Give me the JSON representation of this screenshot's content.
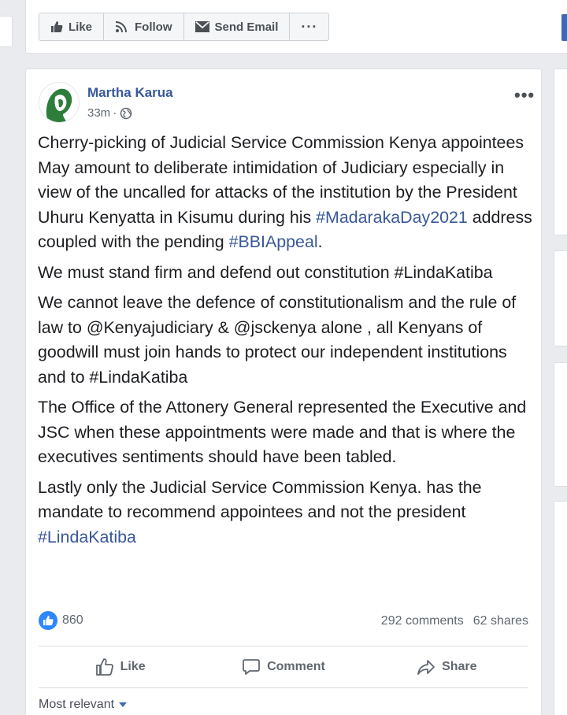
{
  "page_actions": {
    "like": "Like",
    "follow": "Follow",
    "send_email": "Send Email",
    "more": "···"
  },
  "post": {
    "author": "Martha Karua",
    "time": "33m",
    "separator": "·",
    "more": "•••",
    "paragraphs": [
      [
        {
          "t": "Cherry-picking of Judicial Service Commission Kenya appointees May amount to deliberate intimidation of Judiciary especially in view of the uncalled for attacks of the institution by the President Uhuru Kenyatta in Kisumu during his ",
          "tag": false
        },
        {
          "t": "#MadarakaDay2021",
          "tag": true
        },
        {
          "t": " address coupled with the pending ",
          "tag": false
        },
        {
          "t": "#BBIAppeal",
          "tag": true
        },
        {
          "t": ".",
          "tag": false
        }
      ],
      [
        {
          "t": "We must stand firm and defend out constitution #LindaKatiba",
          "tag": false
        }
      ],
      [
        {
          "t": "We cannot leave the defence of constitutionalism and the rule of law to @Kenyajudiciary & @jsckenya alone , all Kenyans of goodwill must join hands to protect our independent institutions and to #LindaKatiba",
          "tag": false
        }
      ],
      [
        {
          "t": "The Office of the Attonery General represented the Executive and JSC when these appointments were made and that is where the executives sentiments should have been tabled.",
          "tag": false
        }
      ],
      [
        {
          "t": "Lastly only the Judicial Service Commission Kenya. has the mandate to recommend appointees and not the president ",
          "tag": false
        },
        {
          "t": "#LindaKatiba",
          "tag": true
        }
      ]
    ],
    "reactions_count": "860",
    "comments": "292 comments",
    "shares": "62 shares",
    "actions": {
      "like": "Like",
      "comment": "Comment",
      "share": "Share"
    },
    "sort": "Most relevant"
  },
  "colors": {
    "link": "#385898",
    "like_blue": "#2d88ff",
    "fb_blue": "#4267b2"
  }
}
